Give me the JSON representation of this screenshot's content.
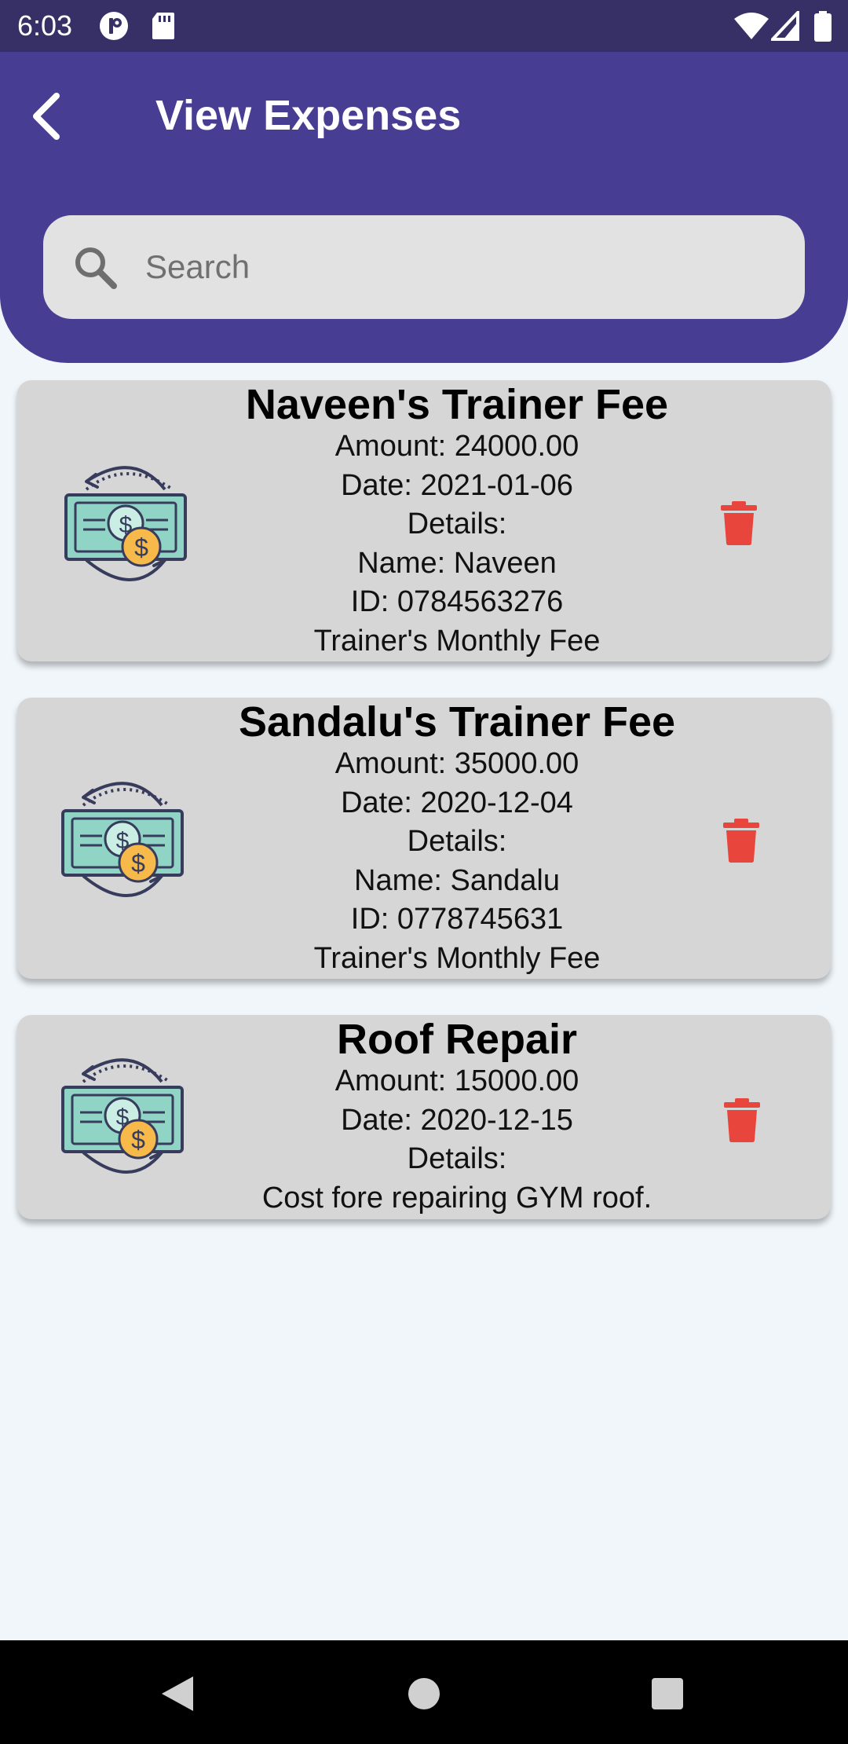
{
  "status_bar": {
    "time": "6:03"
  },
  "header": {
    "title": "View Expenses"
  },
  "search": {
    "placeholder": "Search",
    "value": ""
  },
  "expenses": [
    {
      "title": "Naveen's Trainer Fee",
      "amount": "Amount: 24000.00",
      "date": "Date: 2021-01-06",
      "details_label": "Details:",
      "details_lines": [
        "Name: Naveen",
        "ID: 0784563276",
        "Trainer's Monthly Fee"
      ]
    },
    {
      "title": "Sandalu's Trainer Fee",
      "amount": "Amount: 35000.00",
      "date": "Date: 2020-12-04",
      "details_label": "Details:",
      "details_lines": [
        "Name: Sandalu",
        "ID: 0778745631",
        "Trainer's Monthly Fee"
      ]
    },
    {
      "title": "Roof Repair",
      "amount": "Amount: 15000.00",
      "date": "Date: 2020-12-15",
      "details_label": "Details:",
      "details_lines": [
        "Cost fore repairing GYM roof."
      ]
    }
  ],
  "icons": {
    "back": "arrow-back-icon",
    "search": "search-icon",
    "expense": "money-exchange-icon",
    "delete": "trash-icon"
  },
  "colors": {
    "header": "#473d93",
    "status_bar": "#363067",
    "card": "#d6d6d6",
    "delete": "#e8463c",
    "background": "#f0f6fa"
  }
}
